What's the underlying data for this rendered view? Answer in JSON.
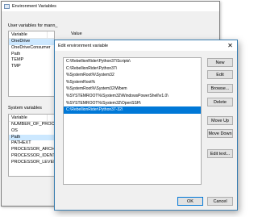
{
  "env_window": {
    "title": "Environment Variables",
    "user_section_label": "User variables for mann_",
    "user_columns": [
      "Variable",
      "Value"
    ],
    "user_vars": [
      "OneDrive",
      "OneDriveConsumer",
      "Path",
      "TEMP",
      "TMP"
    ],
    "system_section_label": "System variables",
    "system_columns": [
      "Variable"
    ],
    "system_vars": [
      "NUMBER_OF_PROCESSORS",
      "OS",
      "Path",
      "PATHEXT",
      "PROCESSOR_ARCHITECTURE",
      "PROCESSOR_IDENTIFIER",
      "PROCESSOR_LEVEL"
    ]
  },
  "edit_dialog": {
    "title": "Edit environment variable",
    "close_glyph": "✕",
    "paths": [
      "C:\\RebellionRider\\Python37\\Scripts\\",
      "C:\\RebellionRider\\Python37\\",
      "%SystemRoot%\\System32",
      "%SystemRoot%",
      "%SystemRoot%\\System32\\Wbem",
      "%SYSTEMROOT%\\System32\\WindowsPowerShell\\v1.0\\",
      "%SYSTEMROOT%\\System32\\OpenSSH\\",
      "C:\\RebellionRider\\Python37-32\\"
    ],
    "selected_index": 7,
    "buttons": {
      "new": "New",
      "edit": "Edit",
      "browse": "Browse...",
      "delete": "Delete",
      "move_up": "Move Up",
      "move_down": "Move Down",
      "edit_text": "Edit text...",
      "ok": "OK",
      "cancel": "Cancel"
    }
  }
}
